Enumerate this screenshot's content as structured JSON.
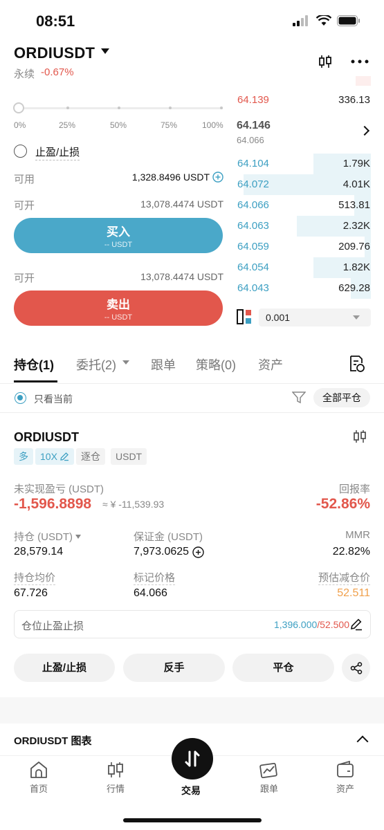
{
  "status_bar": {
    "time": "08:51"
  },
  "header": {
    "symbol": "ORDIUSDT",
    "contract_type": "永续",
    "change": "-0.67%"
  },
  "slider": {
    "value_percent": 0,
    "labels": [
      "0%",
      "25%",
      "50%",
      "75%",
      "100%"
    ]
  },
  "order_form": {
    "tp_sl_label": "止盈/止损",
    "available_label": "可用",
    "available_value": "1,328.8496 USDT",
    "open_label": "可开",
    "open_buy_value": "13,078.4474 USDT",
    "buy_button": {
      "label": "买入",
      "sub": "-- USDT"
    },
    "open_sell_label": "可开",
    "open_sell_value": "13,078.4474 USDT",
    "sell_button": {
      "label": "卖出",
      "sub": "-- USDT"
    }
  },
  "order_book": {
    "asks": [
      {
        "price": "64.139",
        "size": "336.13"
      }
    ],
    "mid_price": "64.146",
    "mark_price": "64.066",
    "bids": [
      {
        "price": "64.104",
        "size": "1.79K",
        "depth": 0.45
      },
      {
        "price": "64.072",
        "size": "4.01K",
        "depth": 1.0
      },
      {
        "price": "64.066",
        "size": "513.81",
        "depth": 0.13
      },
      {
        "price": "64.063",
        "size": "2.32K",
        "depth": 0.58
      },
      {
        "price": "64.059",
        "size": "209.76",
        "depth": 0.05
      },
      {
        "price": "64.054",
        "size": "1.82K",
        "depth": 0.45
      },
      {
        "price": "64.043",
        "size": "629.28",
        "depth": 0.16
      }
    ],
    "precision": "0.001"
  },
  "tabs": [
    {
      "label": "持仓(1)",
      "active": true
    },
    {
      "label": "委托(2)",
      "active": false
    },
    {
      "label": "跟单",
      "active": false
    },
    {
      "label": "策略(0)",
      "active": false
    },
    {
      "label": "资产",
      "active": false
    }
  ],
  "filter": {
    "only_current": "只看当前",
    "close_all": "全部平仓"
  },
  "position": {
    "symbol": "ORDIUSDT",
    "tags": {
      "side": "多",
      "leverage": "10X",
      "margin_mode": "逐仓",
      "currency": "USDT"
    },
    "unrealized_pnl_label": "未实现盈亏 (USDT)",
    "unrealized_pnl_value": "-1,596.8898",
    "unrealized_pnl_cny": "≈ ¥ -11,539.93",
    "roe_label": "回报率",
    "roe_value": "-52.86%",
    "size_label": "持仓 (USDT)",
    "size_value": "28,579.14",
    "margin_label": "保证金 (USDT)",
    "margin_value": "7,973.0625",
    "mmr_label": "MMR",
    "mmr_value": "22.82%",
    "entry_label": "持仓均价",
    "entry_value": "67.726",
    "mark_label": "标记价格",
    "mark_value": "64.066",
    "liq_label": "预估减仓价",
    "liq_value": "52.511",
    "tpsl_label": "仓位止盈止损",
    "tp_value": "1,396.000",
    "sl_value": "/52.500",
    "actions": {
      "tpsl": "止盈/止损",
      "reverse": "反手",
      "close": "平仓"
    }
  },
  "chart_section": {
    "title": "ORDIUSDT 图表"
  },
  "bottom_nav": {
    "home": "首页",
    "market": "行情",
    "trade": "交易",
    "copy": "跟单",
    "assets": "资产"
  },
  "colors": {
    "buy": "#4aa8c9",
    "sell": "#e2574c",
    "accent_blue": "#3c9fc2",
    "liq_orange": "#f0a04b"
  }
}
